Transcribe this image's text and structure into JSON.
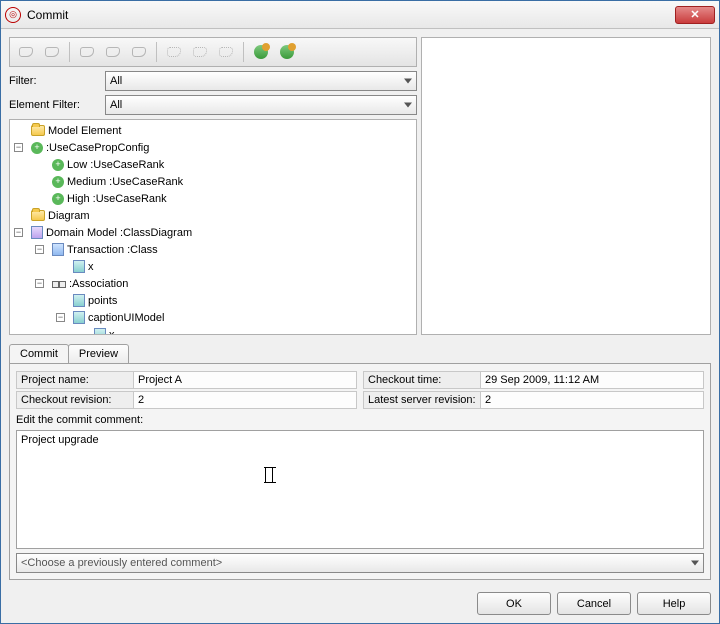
{
  "window": {
    "title": "Commit"
  },
  "filters": {
    "filter_label": "Filter:",
    "filter_value": "All",
    "element_filter_label": "Element Filter:",
    "element_filter_value": "All"
  },
  "tree": {
    "model_element": "Model Element",
    "usecase_prop_config": ":UseCasePropConfig",
    "low_rank": "Low :UseCaseRank",
    "medium_rank": "Medium :UseCaseRank",
    "high_rank": "High :UseCaseRank",
    "diagram": "Diagram",
    "domain_model": "Domain Model :ClassDiagram",
    "transaction": "Transaction :Class",
    "x1": "x",
    "association": ":Association",
    "points": "points",
    "caption_ui_model": "captionUIModel",
    "x2": "x"
  },
  "tabs": {
    "commit": "Commit",
    "preview": "Preview"
  },
  "info": {
    "project_name_label": "Project name:",
    "project_name_value": "Project A",
    "checkout_revision_label": "Checkout revision:",
    "checkout_revision_value": "2",
    "checkout_time_label": "Checkout time:",
    "checkout_time_value": "29 Sep 2009, 11:12 AM",
    "latest_server_revision_label": "Latest server revision:",
    "latest_server_revision_value": "2"
  },
  "commit": {
    "edit_label": "Edit the commit comment:",
    "comment_text": "Project upgrade",
    "prev_placeholder": "<Choose a previously entered comment>"
  },
  "buttons": {
    "ok": "OK",
    "cancel": "Cancel",
    "help": "Help"
  }
}
